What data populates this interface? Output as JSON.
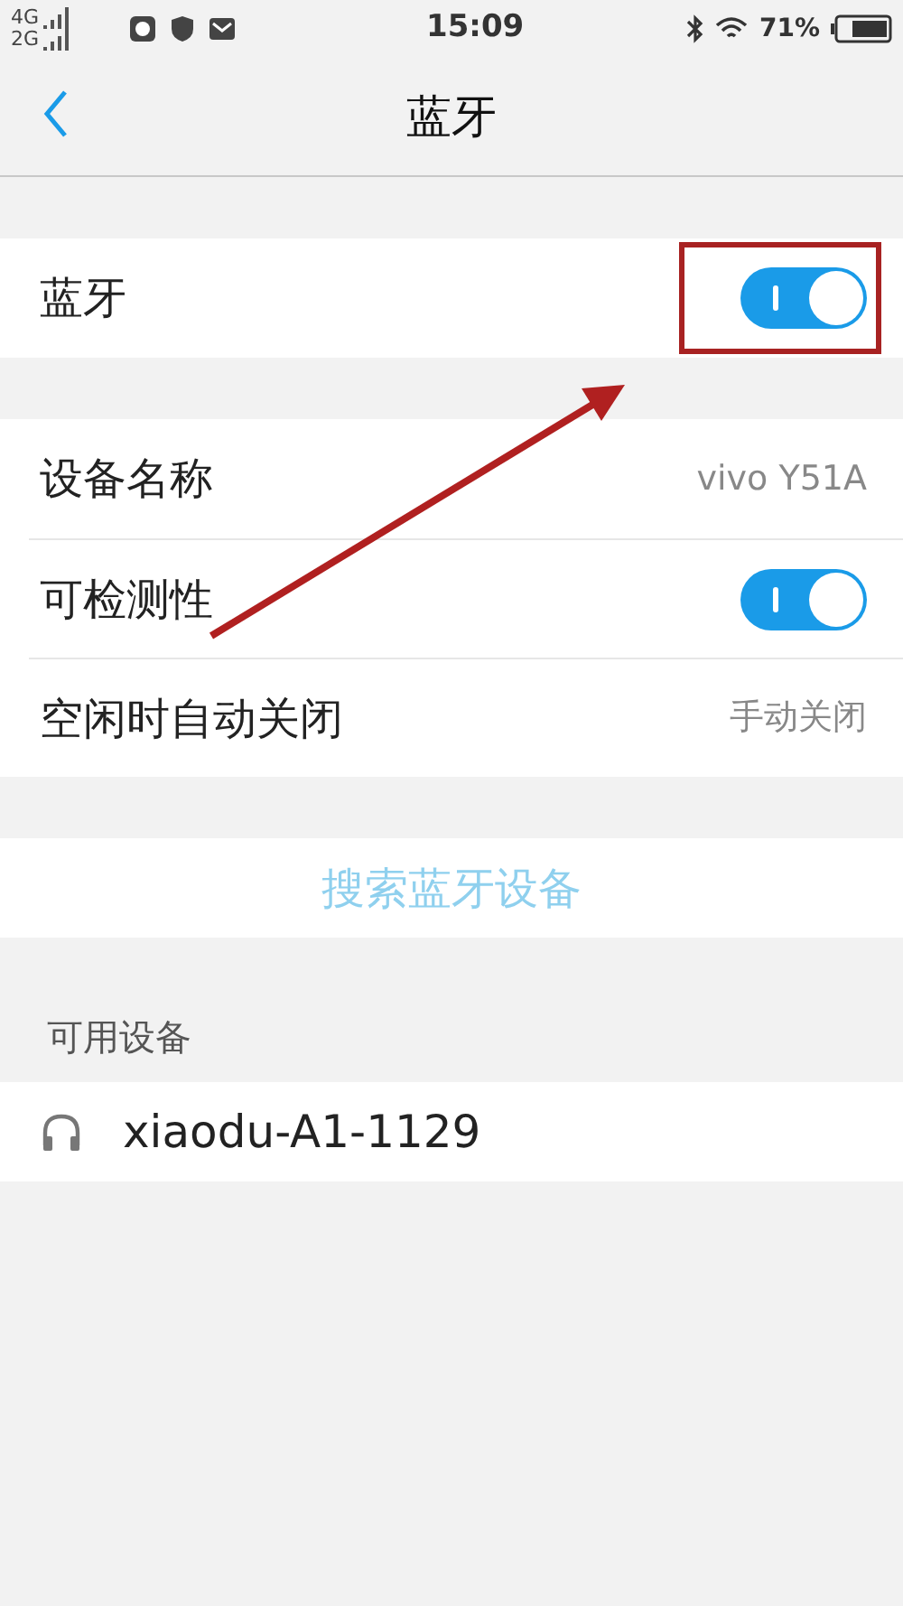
{
  "status_bar": {
    "networks": [
      "4G",
      "2G"
    ],
    "time": "15:09",
    "battery": "71%"
  },
  "header": {
    "title": "蓝牙"
  },
  "sections": [
    {
      "rows": [
        {
          "kind": "toggle",
          "label": "蓝牙",
          "on": true
        }
      ]
    },
    {
      "rows": [
        {
          "kind": "value",
          "label": "设备名称",
          "value": "vivo Y51A"
        },
        {
          "kind": "toggle",
          "label": "可检测性",
          "on": true
        },
        {
          "kind": "value",
          "label": "空闲时自动关闭",
          "value": "手动关闭"
        }
      ]
    }
  ],
  "search_button": "搜索蓝牙设备",
  "available": {
    "title": "可用设备",
    "devices": [
      {
        "name": "xiaodu-A1-1129"
      }
    ]
  }
}
